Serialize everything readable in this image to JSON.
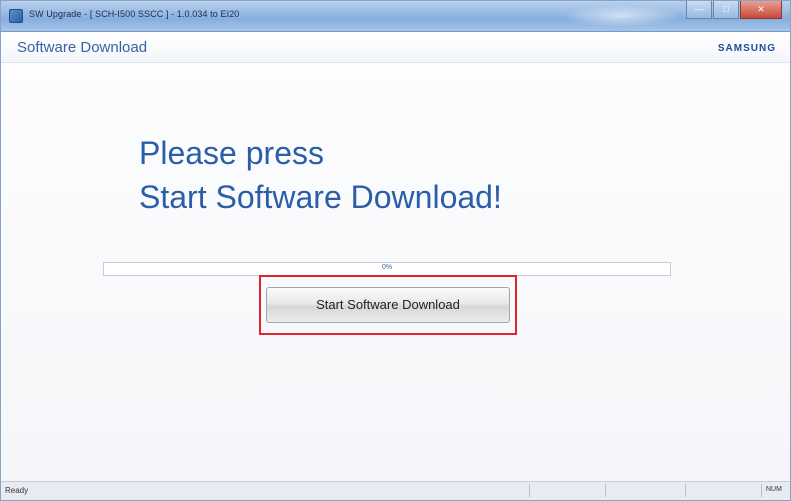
{
  "window": {
    "title": "SW Upgrade - [ SCH-I500 SSCC ] - 1.0.034 to EI20",
    "minimize_glyph": "—",
    "maximize_glyph": "□",
    "close_glyph": "✕"
  },
  "header": {
    "title": "Software Download",
    "brand": "SAMSUNG"
  },
  "main": {
    "prompt_line_1": "Please press",
    "prompt_line_2": "Start Software Download!",
    "progress": {
      "value": 0,
      "label": "0%"
    },
    "start_button_label": "Start Software Download"
  },
  "statusbar": {
    "status": "Ready",
    "num_indicator": "NUM"
  },
  "colors": {
    "accent": "#2b5ea8",
    "highlight": "#e0262b",
    "progress_fill": "#4f9e45"
  }
}
